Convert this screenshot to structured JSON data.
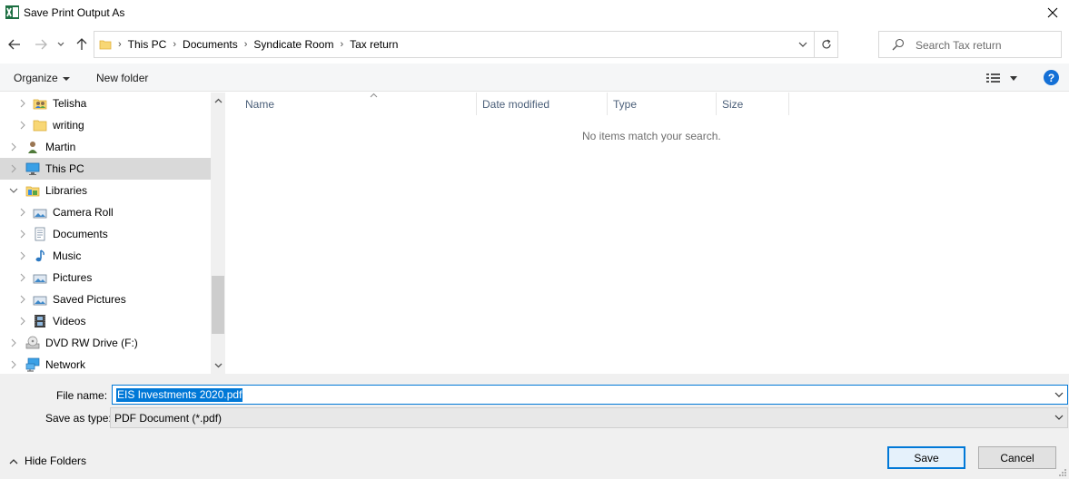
{
  "window": {
    "title": "Save Print Output As"
  },
  "address": {
    "breadcrumbs": [
      "This PC",
      "Documents",
      "Syndicate Room",
      "Tax return"
    ]
  },
  "search": {
    "placeholder": "Search Tax return"
  },
  "toolbar": {
    "organize_label": "Organize",
    "new_folder_label": "New folder",
    "help_label": "?"
  },
  "navpane": {
    "items": [
      {
        "label": "Telisha",
        "icon": "user-folder-icon"
      },
      {
        "label": "writing",
        "icon": "folder-icon"
      },
      {
        "label": "Martin",
        "icon": "user-icon"
      },
      {
        "label": "This PC",
        "icon": "computer-icon",
        "selected": true
      },
      {
        "label": "Libraries",
        "icon": "libraries-icon",
        "expanded": true
      },
      {
        "label": "Camera Roll",
        "icon": "pictures-library-icon"
      },
      {
        "label": "Documents",
        "icon": "documents-library-icon"
      },
      {
        "label": "Music",
        "icon": "music-library-icon"
      },
      {
        "label": "Pictures",
        "icon": "pictures-library-icon"
      },
      {
        "label": "Saved Pictures",
        "icon": "pictures-library-icon"
      },
      {
        "label": "Videos",
        "icon": "videos-library-icon"
      },
      {
        "label": "DVD RW Drive (F:)",
        "icon": "dvd-drive-icon"
      },
      {
        "label": "Network",
        "icon": "network-icon"
      }
    ]
  },
  "filelist": {
    "columns": [
      "Name",
      "Date modified",
      "Type",
      "Size"
    ],
    "empty_message": "No items match your search."
  },
  "form": {
    "filename_label": "File name:",
    "filename_value": "EIS Investments 2020.pdf",
    "savetype_label": "Save as type:",
    "savetype_value": "PDF Document (*.pdf)"
  },
  "footer": {
    "hide_folders_label": "Hide Folders",
    "save_label": "Save",
    "cancel_label": "Cancel"
  },
  "colors": {
    "accent": "#0078d7",
    "selection": "#d9d9d9",
    "toolbar_bg": "#f5f6f7",
    "footer_bg": "#f0f0f0"
  }
}
